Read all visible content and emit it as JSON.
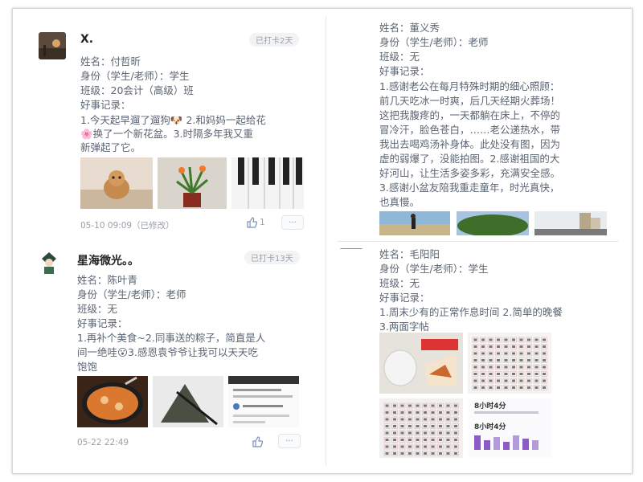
{
  "posts": [
    {
      "author": "X.",
      "badge": "已打卡2天",
      "fields": {
        "name": "姓名：付哲昕",
        "identity": "身份（学生/老师）：学生",
        "class": "班级：20会计（高级）班",
        "records_label": "好事记录："
      },
      "content_lines": [
        "1.今天起早遛了遛狗🐶 2.和妈妈一起给花",
        "🌸换了一个新花盆。3.时隔多年我又重",
        "新弹起了它。"
      ],
      "timestamp": "05-10 09:09（已修改）",
      "like_count": "1",
      "more_label": "···"
    },
    {
      "author": "星海微光。。",
      "badge": "已打卡13天",
      "fields": {
        "name": "姓名：陈叶青",
        "identity": "身份（学生/老师）：老师",
        "class": "班级：无",
        "records_label": "好事记录："
      },
      "content_lines": [
        "1.再补个美食~2.同事送的粽子，简直是人",
        "间一绝哇😮3.感恩袁爷爷让我可以天天吃",
        "饱饱"
      ],
      "timestamp": "05-22 22:49",
      "like_count": "",
      "more_label": "···"
    },
    {
      "author": "",
      "badge": "",
      "fields": {
        "name": "姓名：董义秀",
        "identity": "身份（学生/老师）：老师",
        "class": "班级：无",
        "records_label": "好事记录："
      },
      "content_lines": [
        "1.感谢老公在每月特殊时期的细心照顾：",
        "前几天吃冰一时爽，后几天经期火葬场！",
        "这把我腹疼的，一天都躺在床上，不停的",
        "冒冷汗，脸色苍白，……老公递热水，带",
        "我出去喝鸡汤补身体。此处没有图，因为",
        "虚的弱爆了，没能拍图。2.感谢祖国的大",
        "好河山，让生活多姿多彩，充满安全感。",
        "3.感谢小盆友陪我重走童年，时光真快，",
        "也真慢。"
      ]
    },
    {
      "author": "",
      "badge": "",
      "fields": {
        "name": "姓名：毛阳阳",
        "identity": "身份（学生/老师）：学生",
        "class": "班级：无",
        "records_label": "好事记录："
      },
      "content_lines": [
        "1.周末少有的正常作息时间 2.简单的晚餐",
        "3.两面字帖"
      ],
      "screen_text_1": "8小时4分",
      "screen_text_2": "8小时4分"
    }
  ],
  "icons": {
    "like": "thumbs-up-icon",
    "more": "more-icon"
  },
  "colors": {
    "text": "#5a6472",
    "muted": "#9aa0a8",
    "badge_bg": "#f2f3f5"
  }
}
